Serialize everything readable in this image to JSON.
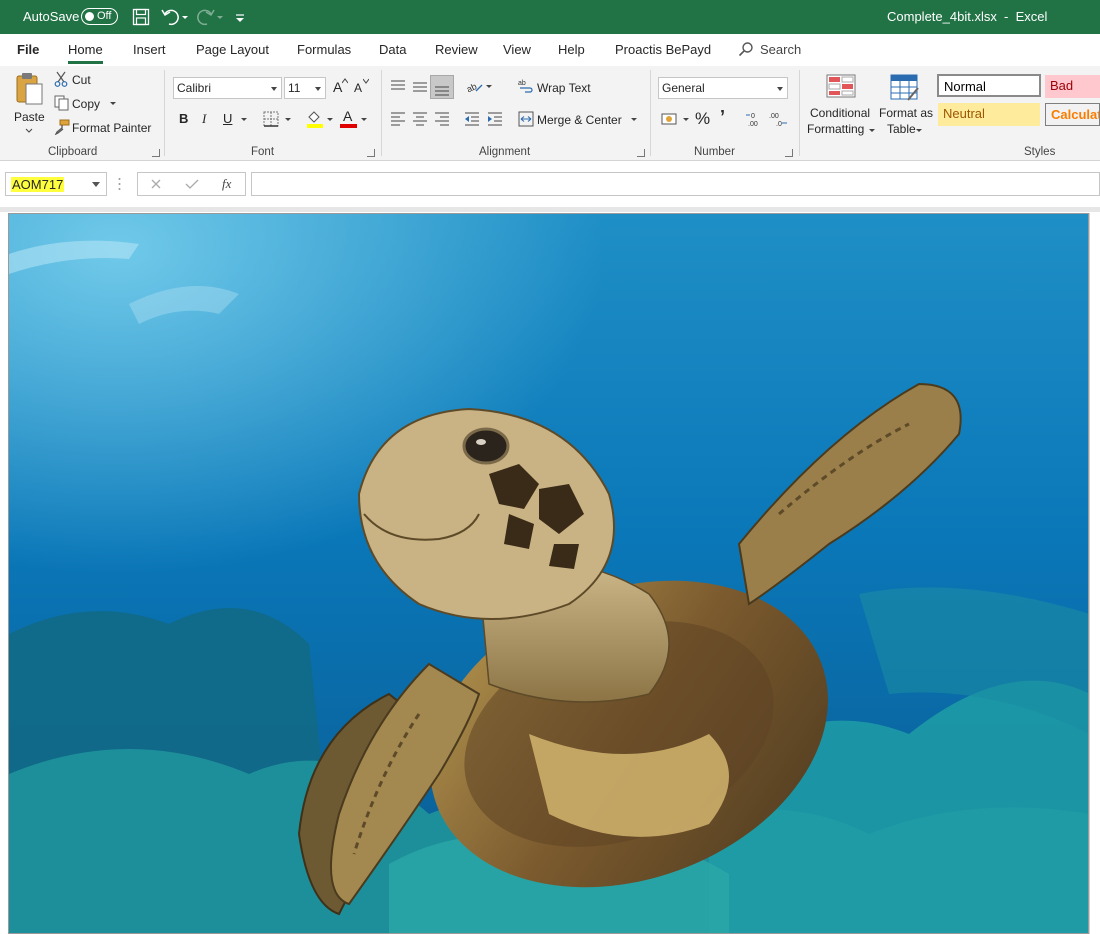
{
  "titlebar": {
    "autosave_label": "AutoSave",
    "autosave_state": "Off",
    "document_title": "Complete_4bit.xlsx  -  Excel"
  },
  "tabs": [
    {
      "label": "File"
    },
    {
      "label": "Home"
    },
    {
      "label": "Insert"
    },
    {
      "label": "Page Layout"
    },
    {
      "label": "Formulas"
    },
    {
      "label": "Data"
    },
    {
      "label": "Review"
    },
    {
      "label": "View"
    },
    {
      "label": "Help"
    },
    {
      "label": "Proactis BePayd"
    }
  ],
  "search_label": "Search",
  "clipboard": {
    "paste": "Paste",
    "cut": "Cut",
    "copy": "Copy",
    "format_painter": "Format Painter",
    "group_label": "Clipboard"
  },
  "font": {
    "name": "Calibri",
    "size": "11",
    "bold": "B",
    "italic": "I",
    "underline": "U",
    "grow": "A",
    "shrink": "A",
    "font_color_glyph": "A",
    "group_label": "Font"
  },
  "alignment": {
    "wrap_text": "Wrap Text",
    "merge_center": "Merge & Center",
    "group_label": "Alignment"
  },
  "number": {
    "format": "General",
    "percent": "%",
    "comma": "’",
    "group_label": "Number"
  },
  "styles_cmds": {
    "conditional_line1": "Conditional",
    "conditional_line2": "Formatting",
    "format_table_line1": "Format as",
    "format_table_line2": "Table",
    "group_label": "Styles"
  },
  "cell_styles": [
    {
      "label": "Normal",
      "bg": "#ffffff",
      "color": "#000000",
      "border": "#8a8a8a"
    },
    {
      "label": "Bad",
      "bg": "#ffc7ce",
      "color": "#9c0006",
      "border": "#ffc7ce"
    },
    {
      "label": "Neutral",
      "bg": "#ffeb9c",
      "color": "#9c5700",
      "border": "#ffeb9c"
    },
    {
      "label": "Calculation",
      "bg": "#f2f2f2",
      "color": "#fa7d00",
      "border": "#7f7f7f"
    }
  ],
  "formula_bar": {
    "name_box": "AOM717",
    "fx": "fx",
    "formula": ""
  },
  "colors": {
    "excel_green": "#217346",
    "name_highlight": "#ffff3d"
  }
}
